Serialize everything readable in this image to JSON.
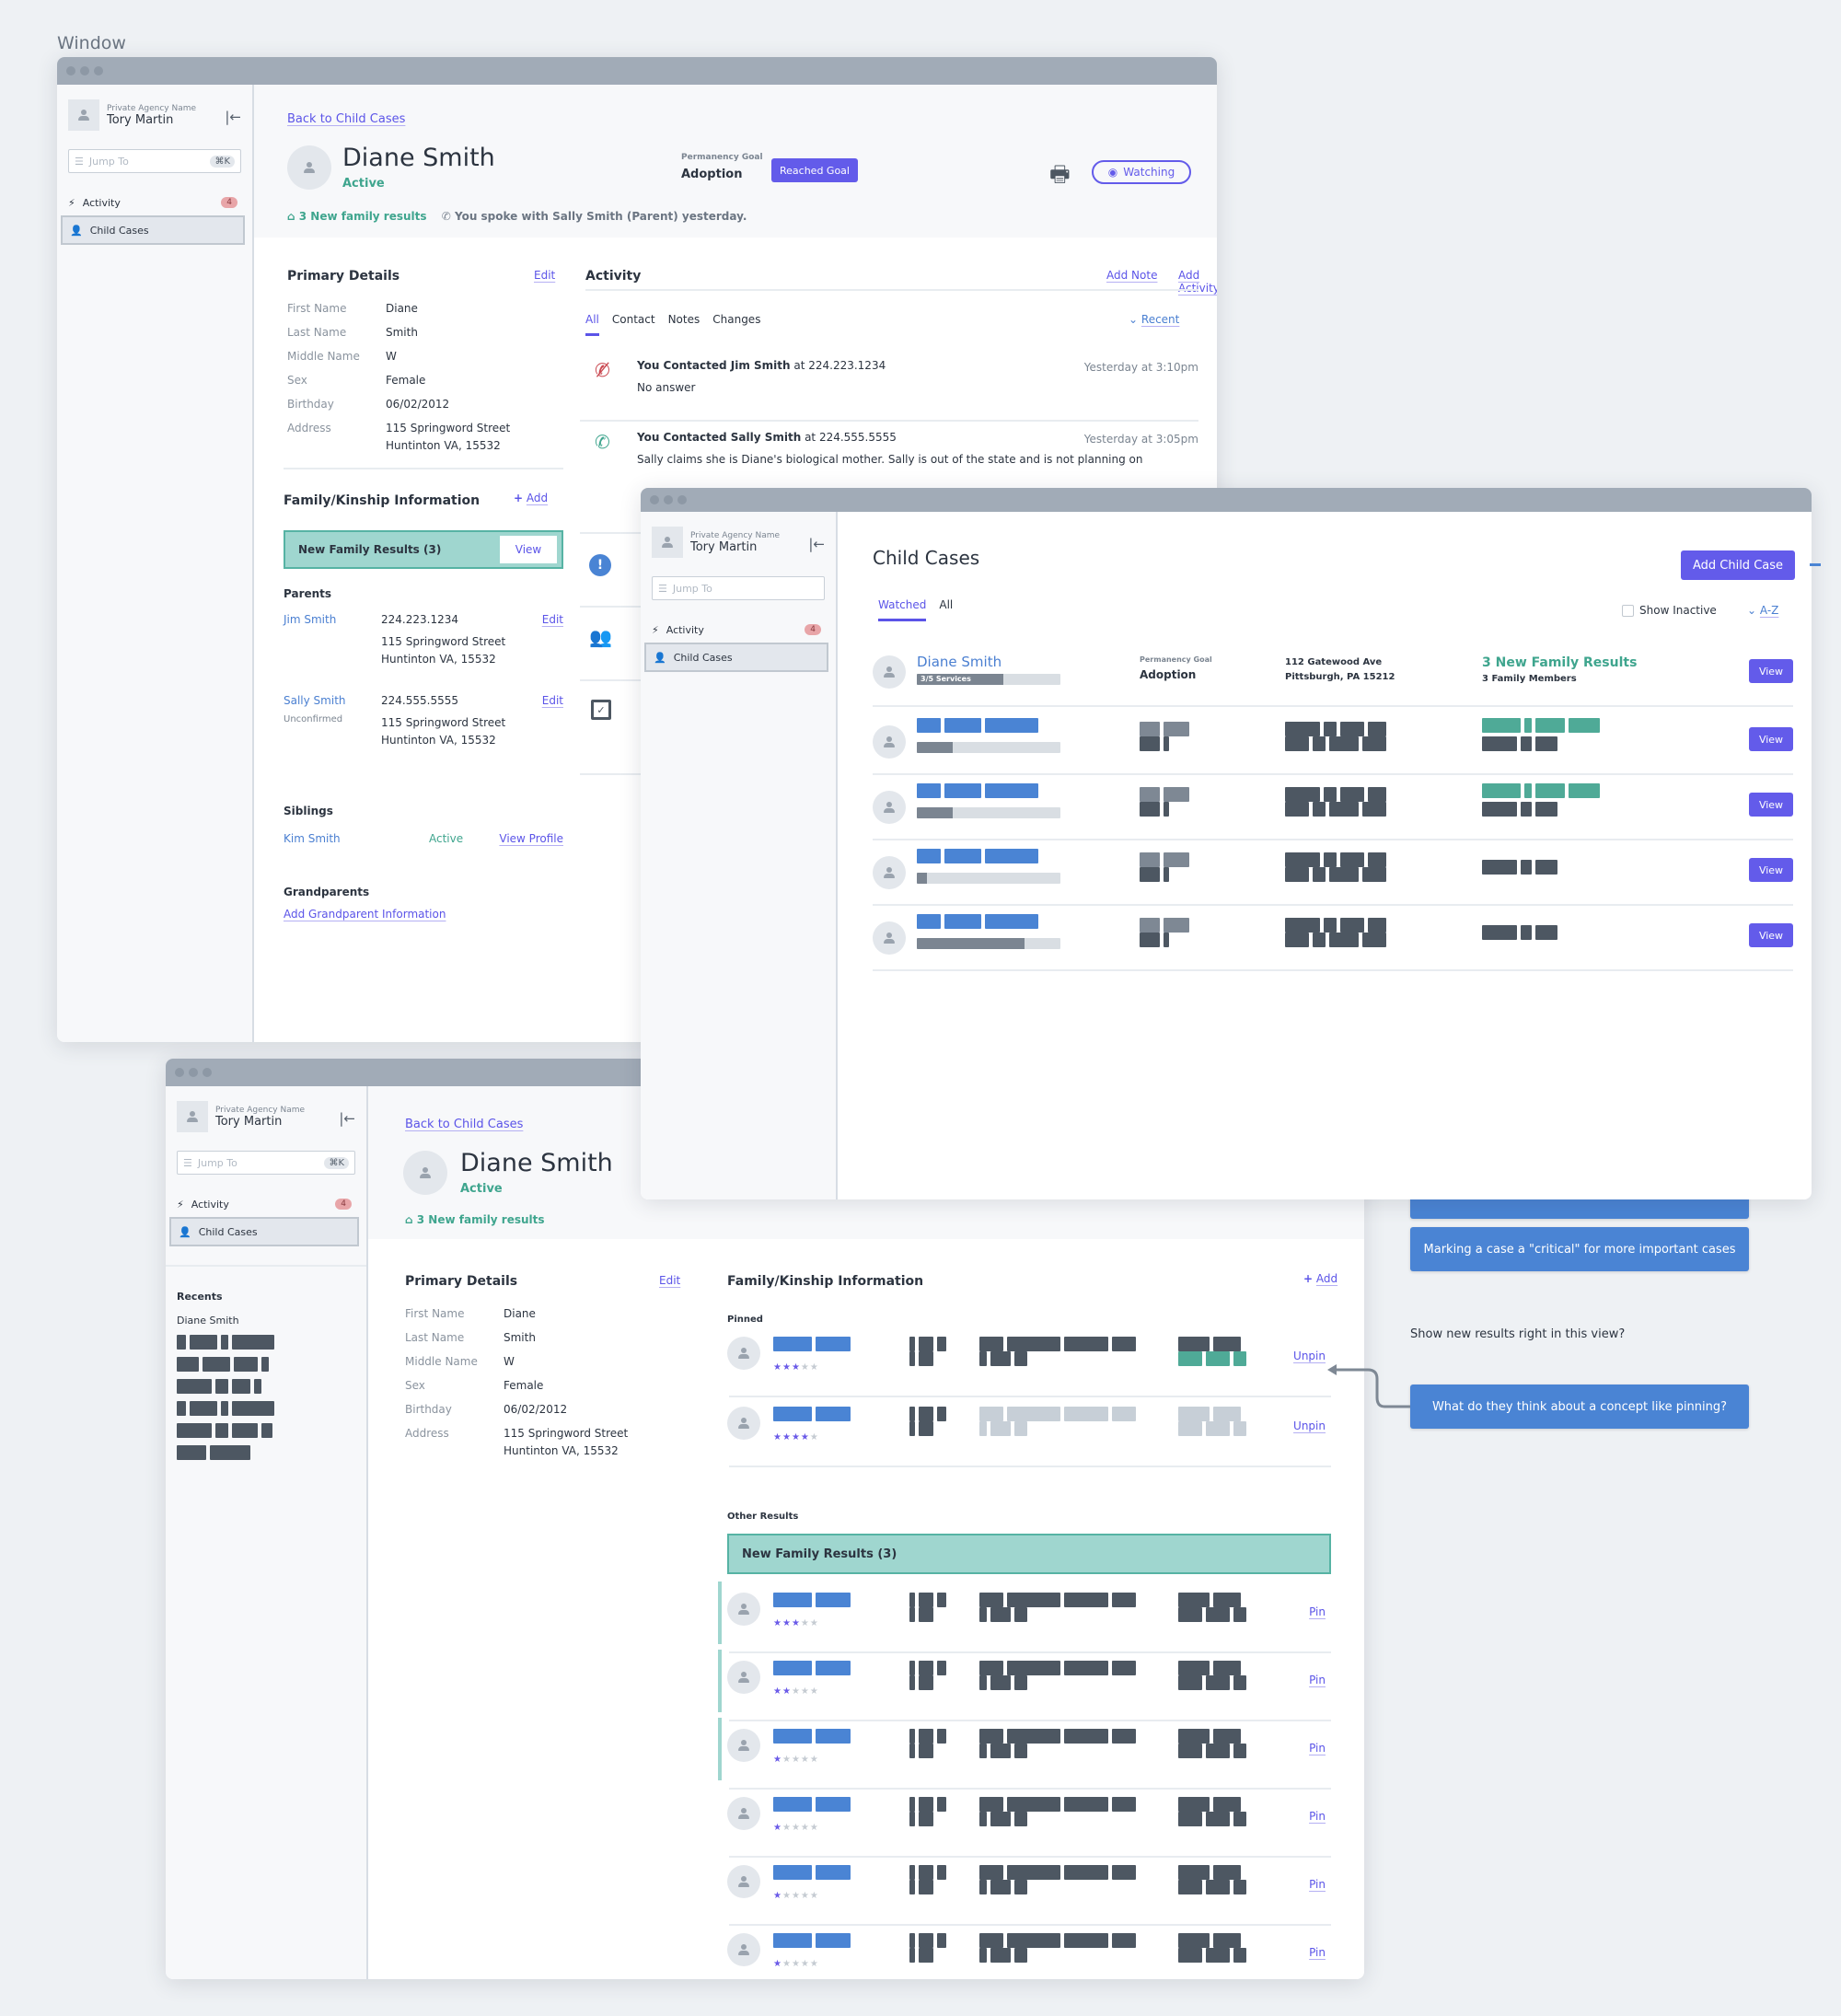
{
  "canvas": {
    "label": "Window"
  },
  "sidebar": {
    "agency": "Private Agency Name",
    "user": "Tory Martin",
    "jump_placeholder": "Jump To",
    "jump_shortcut": "⌘K",
    "nav": [
      {
        "label": "Activity",
        "icon": "bolt-icon",
        "badge": "4"
      },
      {
        "label": "Child Cases",
        "icon": "child-icon",
        "selected": true
      }
    ],
    "recents_title": "Recents",
    "recents": [
      "Diane Smith"
    ]
  },
  "profile": {
    "back_link": "Back to Child Cases",
    "name": "Diane Smith",
    "status": "Active",
    "permanency_label": "Permanency Goal",
    "permanency_value": "Adoption",
    "reached_goal_label": "Reached Goal",
    "watching_label": "Watching",
    "family_results": "3 New family results",
    "last_contact": "You spoke with Sally Smith (Parent) yesterday."
  },
  "primary_details": {
    "title": "Primary Details",
    "edit_label": "Edit",
    "fields": [
      {
        "label": "First Name",
        "value": "Diane"
      },
      {
        "label": "Last Name",
        "value": "Smith"
      },
      {
        "label": "Middle Name",
        "value": "W"
      },
      {
        "label": "Sex",
        "value": "Female"
      },
      {
        "label": "Birthday",
        "value": "06/02/2012"
      },
      {
        "label": "Address",
        "value": "115 Springword Street",
        "value2": "Huntinton VA, 15532"
      }
    ]
  },
  "family": {
    "title": "Family/Kinship Information",
    "add_label": "Add",
    "new_results_label": "New Family Results (3)",
    "view_label": "View",
    "parents_title": "Parents",
    "parents": [
      {
        "name": "Jim Smith",
        "sub": "",
        "phone": "224.223.1234",
        "addr1": "115 Springword Street",
        "addr2": "Huntinton VA, 15532",
        "edit": "Edit"
      },
      {
        "name": "Sally Smith",
        "sub": "Unconfirmed",
        "phone": "224.555.5555",
        "addr1": "115 Springword Street",
        "addr2": "Huntinton VA, 15532",
        "edit": "Edit"
      }
    ],
    "siblings_title": "Siblings",
    "siblings": [
      {
        "name": "Kim Smith",
        "status": "Active",
        "link": "View Profile"
      }
    ],
    "grandparents_title": "Grandparents",
    "grandparents_link": "Add Grandparent Information"
  },
  "activity": {
    "title": "Activity",
    "add_note": "Add Note",
    "add_activity": "Add Activity",
    "tabs": [
      "All",
      "Contact",
      "Notes",
      "Changes"
    ],
    "active_tab": "All",
    "sort_label": "Recent",
    "items": [
      {
        "icon": "missed-call-icon",
        "title": "You Contacted Jim Smith",
        "suffix": " at 224.223.1234",
        "time": "Yesterday at 3:10pm",
        "body": "No answer"
      },
      {
        "icon": "phone-call-icon",
        "title": "You Contacted Sally Smith",
        "suffix": " at 224.555.5555",
        "time": "Yesterday at 3:05pm",
        "body": "Sally claims she is Diane's biological mother. Sally is out of the state and is not planning on"
      }
    ],
    "more_icons": [
      "alert-icon",
      "people-icon",
      "inbox-check-icon"
    ]
  },
  "child_cases": {
    "title": "Child Cases",
    "add_button": "Add Child Case",
    "tabs": [
      "Watched",
      "All"
    ],
    "active_tab": "Watched",
    "show_inactive": "Show Inactive",
    "show_inactive_checked": false,
    "sort_label": "A-Z",
    "view_label": "View",
    "first_case": {
      "name": "Diane Smith",
      "services": "3/5 Services",
      "services_progress": 0.6,
      "goal_label": "Permanency Goal",
      "goal_value": "Adoption",
      "addr1": "112 Gatewood Ave",
      "addr2": "Pittsburgh, PA 15212",
      "results": "3 New Family Results",
      "members": "3 Family Members"
    },
    "placeholder_rows_progress": [
      0.25,
      0.25,
      0.07,
      0.75
    ],
    "placeholder_rows_has_results": [
      true,
      true,
      false,
      false
    ]
  },
  "kinship_view": {
    "pinned_title": "Pinned",
    "other_title": "Other Results",
    "new_results_label": "New Family Results (3)",
    "unpin_label": "Unpin",
    "pin_label": "Pin",
    "pinned_ratings": [
      3,
      4
    ],
    "other_ratings": [
      3,
      2,
      1,
      1,
      1,
      1
    ],
    "other_new_count": 3
  },
  "notes": [
    {
      "text": "Marking a case a \"critical\" for more important cases"
    },
    {
      "text": "Show new results right in this view?"
    },
    {
      "text": "What do they think about a concept like pinning?"
    }
  ]
}
